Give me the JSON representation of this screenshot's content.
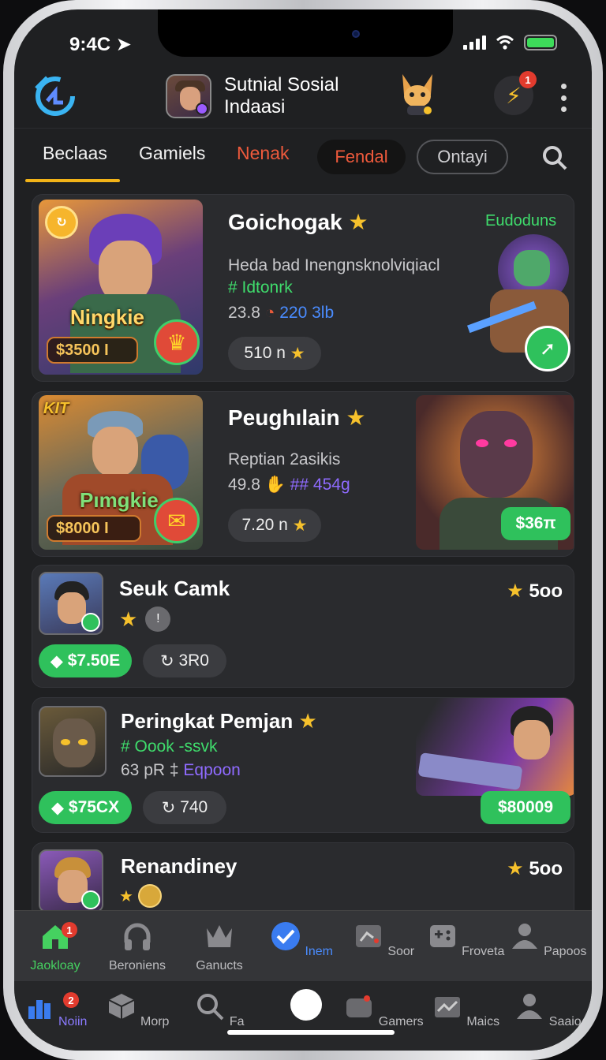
{
  "status": {
    "time": "9:4C"
  },
  "header": {
    "title_line1": "Sutnial Sosial",
    "title_line2": "Indaasi",
    "notif_count": "1"
  },
  "tabs": [
    {
      "label": "Beclaas"
    },
    {
      "label": "Gamiels"
    },
    {
      "label": "Nenak"
    },
    {
      "label": "Fendal"
    },
    {
      "label": "Ontayi"
    }
  ],
  "cards": [
    {
      "thumb_title": "Ningkie",
      "thumb_price": "$3500 I",
      "title": "Goichogak",
      "tag": "Eudoduns",
      "desc": "Heda bad Inengnsknolviqiacl",
      "hashtag": "# Idtonrk",
      "stat_value": "23.8",
      "stat_count": "220 3lb",
      "pill": "510 n"
    },
    {
      "thumb_badge": "KIT",
      "thumb_title": "Pımgkie",
      "thumb_price": "$8000 I",
      "title": "Peughılain",
      "desc": "Reptian 2asikis",
      "stat_value": "49.8",
      "stat_count": "## 454g",
      "pill": "7.20 n",
      "price": "$36π"
    },
    {
      "title": "Seuk Camk",
      "rating": "5oo",
      "price": "$7.50E",
      "count": "3R0"
    },
    {
      "title": "Peringkat Pemjan",
      "hashtag": "# Oook -ssvk",
      "stat_value": "63 pR",
      "stat_extra": "Eqpoon",
      "price": "$75CX",
      "count": "740",
      "price2": "$80009"
    },
    {
      "title": "Renandiney",
      "rating": "5oo"
    }
  ],
  "nav_primary": [
    {
      "label": "Jaokloay",
      "badge": "1",
      "icon": "home-icon"
    },
    {
      "label": "Beroniens",
      "icon": "headphones-icon"
    },
    {
      "label": "Ganucts",
      "icon": "crown-icon"
    },
    {
      "label": "Inem",
      "icon": "check-icon"
    },
    {
      "label": "Soor",
      "icon": "chart-icon"
    },
    {
      "label": "Froveta",
      "icon": "gamepad-icon"
    },
    {
      "label": "Papoos",
      "icon": "person-icon"
    }
  ],
  "nav_secondary": [
    {
      "label": "Noiin",
      "badge": "2",
      "icon": "stats-icon"
    },
    {
      "label": "Morp",
      "icon": "cube-icon"
    },
    {
      "label": "Fa",
      "icon": "search-icon"
    },
    {
      "label": "Gamers",
      "icon": "controller-icon"
    },
    {
      "label": "Maics",
      "icon": "mail-icon"
    },
    {
      "label": "Saaio",
      "icon": "person-icon"
    }
  ]
}
